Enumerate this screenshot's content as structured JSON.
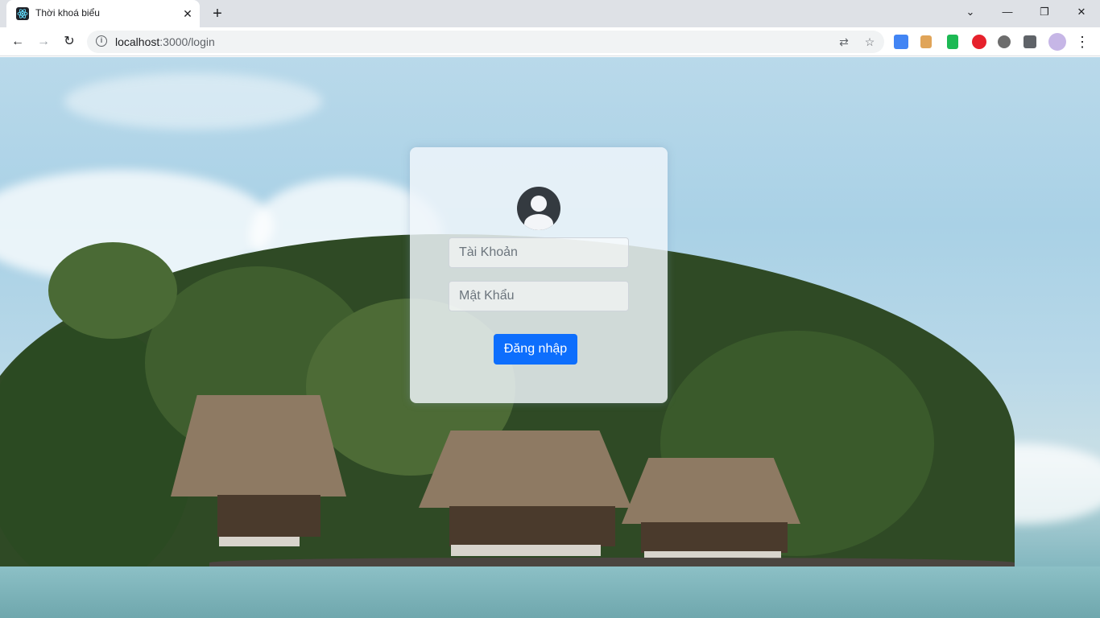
{
  "browser": {
    "tab": {
      "title": "Thời khoá biểu",
      "favicon": "react-icon",
      "close_glyph": "✕"
    },
    "new_tab_glyph": "+",
    "window_controls": {
      "dropdown": "⌄",
      "minimize": "—",
      "restore": "❐",
      "close": "✕"
    },
    "toolbar": {
      "back": "←",
      "forward": "→",
      "reload": "↻",
      "url_host": "localhost",
      "url_path": ":3000/login",
      "info_glyph": "i",
      "translate_glyph": "⇄",
      "star_glyph": "☆",
      "menu_glyph": "⋮"
    },
    "extensions": [
      {
        "name": "google-translate-ext-icon",
        "color": "#4285f4"
      },
      {
        "name": "ruler-ext-icon",
        "color": "#e0a458"
      },
      {
        "name": "bookmark-ext-icon",
        "color": "#1db954"
      },
      {
        "name": "adblock-plus-ext-icon",
        "color": "#e6212c"
      },
      {
        "name": "bug-ext-icon",
        "color": "#6d6d6d"
      },
      {
        "name": "puzzle-ext-icon",
        "color": "#5f6368"
      },
      {
        "name": "profile-avatar-icon",
        "color": "#c6b6e6"
      }
    ]
  },
  "login": {
    "avatar_icon": "user-circle-icon",
    "username_placeholder": "Tài Khoản",
    "password_placeholder": "Mật Khẩu",
    "submit_label": "Đăng nhập",
    "button_color": "#0d6efd"
  },
  "background": {
    "scene": "beach-huts-photo"
  }
}
